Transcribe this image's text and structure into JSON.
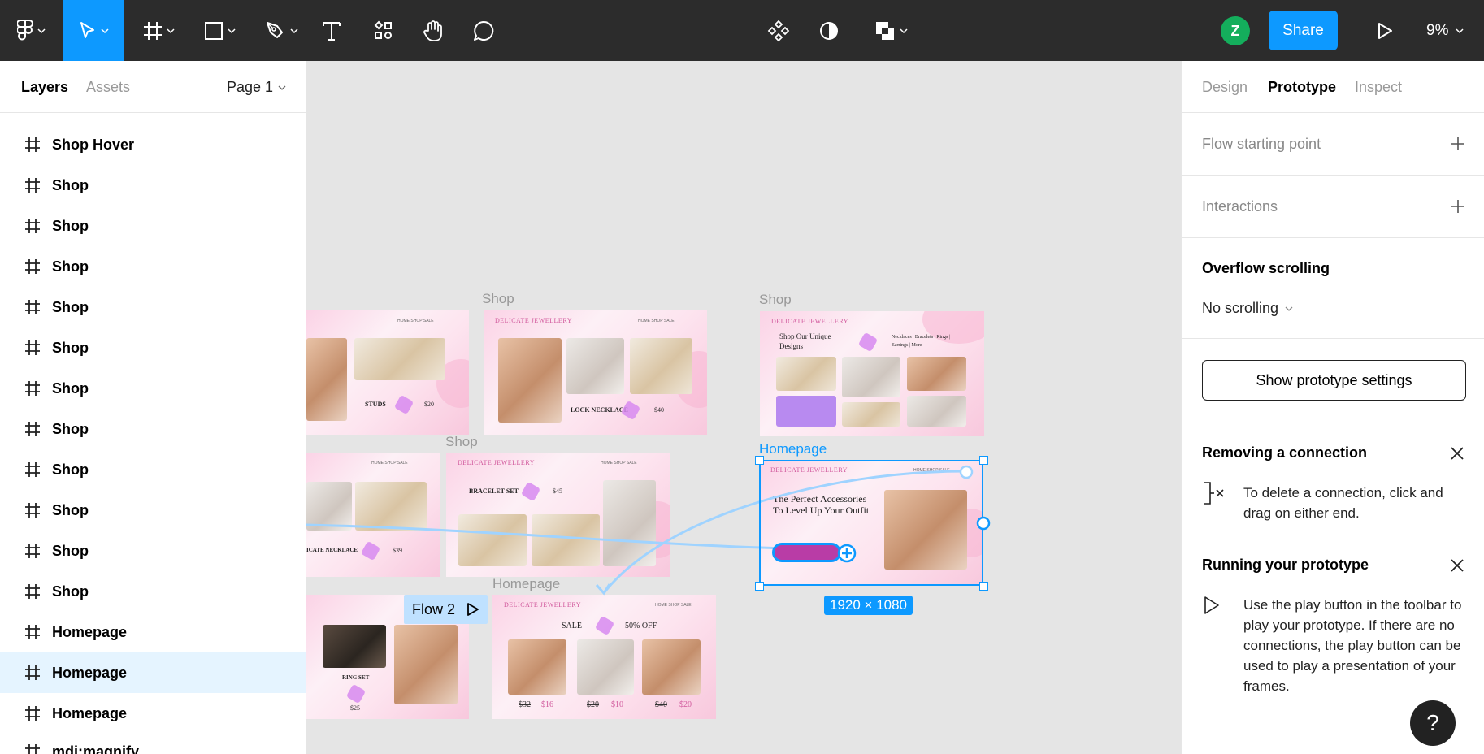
{
  "toolbar": {
    "avatar_initial": "Z",
    "share_label": "Share",
    "zoom_level": "9%",
    "tools": [
      "figma-menu-icon",
      "move-tool-icon",
      "frame-tool-icon",
      "shape-tool-icon",
      "pen-tool-icon",
      "text-tool-icon",
      "resources-icon",
      "hand-tool-icon",
      "comment-tool-icon",
      "component-icon",
      "mask-icon",
      "boolean-icon",
      "play-icon"
    ],
    "accent": "#0d99ff"
  },
  "left_panel": {
    "tab_layers": "Layers",
    "tab_assets": "Assets",
    "page": "Page 1",
    "layers": [
      "Shop Hover",
      "Shop",
      "Shop",
      "Shop",
      "Shop",
      "Shop",
      "Shop",
      "Shop",
      "Shop",
      "Shop",
      "Shop",
      "Shop",
      "Homepage",
      "Homepage",
      "Homepage"
    ],
    "partial_last_layer": "mdi:magnify",
    "selected_index": 13
  },
  "right_panel": {
    "tab_design": "Design",
    "tab_prototype": "Prototype",
    "tab_inspect": "Inspect",
    "flow_starting_point": "Flow starting point",
    "interactions": "Interactions",
    "overflow_title": "Overflow scrolling",
    "overflow_value": "No scrolling",
    "proto_settings_button": "Show prototype settings",
    "tip1_title": "Removing a connection",
    "tip1_text": "To delete a connection, click and drag on either end.",
    "tip2_title": "Running your prototype",
    "tip2_text": "Use the play button in the toolbar to play your prototype. If there are no connections, the play button can be used to play a presentation of your frames.",
    "help": "?"
  },
  "canvas": {
    "labels": {
      "shop_a": "Shop",
      "shop_b": "Shop",
      "shop_c": "Shop",
      "homepage_sel": "Homepage",
      "homepage_b": "Homepage"
    },
    "selection_size": "1920 × 1080",
    "flow_tag": "Flow 2",
    "frames": {
      "logo": "DELICATE JEWELLERY",
      "nav": "HOME   SHOP   SALE",
      "studs": "STUDS",
      "studs_price": "$20",
      "lock_necklace": "LOCK NECKLACE",
      "lock_price": "$40",
      "shop_unique": "Shop Our Unique Designs",
      "categories": "Necklaces | Bracelets | Rings | Earrings | More",
      "bracelet_set": "BRACELET SET",
      "bracelet_price": "$45",
      "cate_necklace": "ICATE NECKLACE",
      "cate_price": "$39",
      "hero_text": "The Perfect Accessories To Level Up Your Outfit",
      "ring_set": "RING SET",
      "ring_price": "$25",
      "sale": "SALE",
      "sale_off": "50% OFF",
      "p1_old": "$32",
      "p1_new": "$16",
      "p2_old": "$20",
      "p2_new": "$10",
      "p3_old": "$40",
      "p3_new": "$20"
    }
  }
}
